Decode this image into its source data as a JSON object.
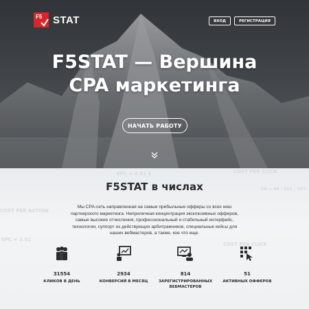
{
  "brand": {
    "logo_box_text": "F5",
    "name": "STAT"
  },
  "nav": {
    "login": "ВХОД",
    "register": "РЕГИСТРАЦИЯ"
  },
  "hero": {
    "title_line1": "F5STAT — Вершина",
    "title_line2": "CPA маркетинга",
    "cta": "НАЧАТЬ РАБОТУ"
  },
  "background_terms": [
    "EPC = 2.51 $",
    "COST PER CLICK",
    "CR = 64 / 214 – 30%",
    "COST PER ACTION",
    "EPC = 2.51",
    "COST PER CLICK"
  ],
  "stats": {
    "title": "F5STAT в числах",
    "description": "Мы CPA-сеть направленная на самые прибыльные офферы со всех ниш партнерского маркетинга. Неприличная концентрация эксклюзивных офферов, самые высокие отчисления, профессиональный и стабильный интерфейс, технологии, суппорт из действующих арбитражников, специальные кейсы для наших вебмастеров, а также, кое что еще.",
    "items": [
      {
        "icon": "people-icon",
        "value": "31554",
        "label": "КЛИКОВ В ДЕНЬ"
      },
      {
        "icon": "presentation-icon",
        "value": "2934",
        "label": "КОНВЕРСИЙ В МЕСЯЦ"
      },
      {
        "icon": "webmaster-icon",
        "value": "814",
        "label": "ЗАРЕГИСТРИРОВАННЫХ ВЕБМАСТЕРОВ"
      },
      {
        "icon": "click-grid-icon",
        "value": "51",
        "label": "АКТИВНЫХ ОФФЕРОВ"
      }
    ]
  },
  "colors": {
    "brand_red": "#d7262b",
    "text_dark": "#2b2b2b"
  }
}
